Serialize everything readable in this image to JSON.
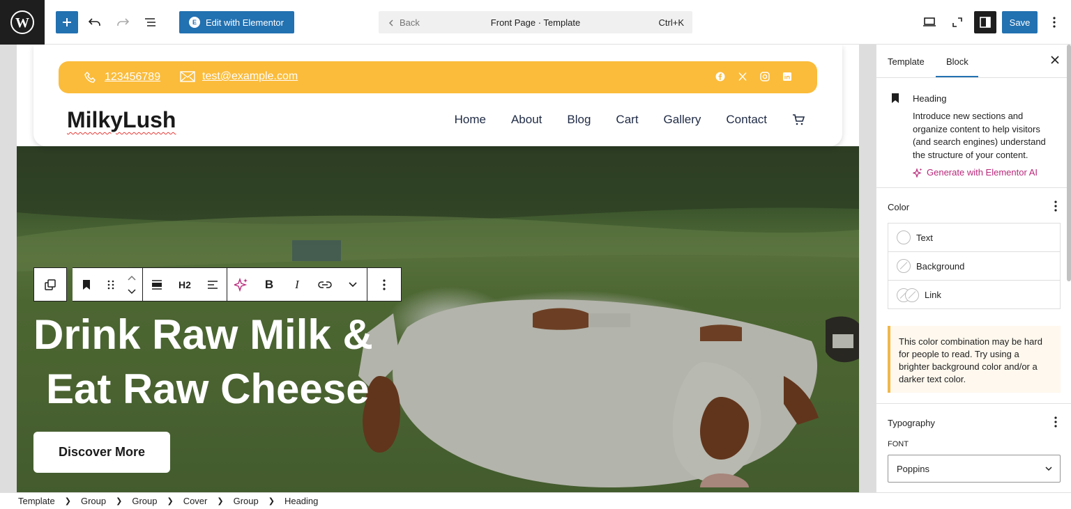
{
  "topbar": {
    "edit_with_elementor": "Edit with Elementor",
    "elementor_badge": "E",
    "back_label": "Back",
    "document_title": "Front Page · Template",
    "shortcut": "Ctrl+K",
    "save_label": "Save"
  },
  "site": {
    "phone": "123456789",
    "email": "test@example.com",
    "logo": "MilkyLush",
    "nav": [
      "Home",
      "About",
      "Blog",
      "Cart",
      "Gallery",
      "Contact"
    ],
    "social_icons": [
      "facebook-icon",
      "x-icon",
      "instagram-icon",
      "linkedin-icon"
    ],
    "accent_color": "#fbbc3b"
  },
  "hero": {
    "title_line1": "Drink Raw Milk &",
    "title_line2": "Eat Raw Cheese",
    "button": "Discover More"
  },
  "block_toolbar": {
    "heading_level": "H2",
    "bold": "B",
    "italic": "I"
  },
  "sidebar": {
    "tabs": [
      "Template",
      "Block"
    ],
    "active_tab": "Block",
    "block": {
      "name": "Heading",
      "description": "Introduce new sections and organize content to help visitors (and search engines) understand the structure of your content.",
      "ai_link": "Generate with Elementor AI"
    },
    "color": {
      "title": "Color",
      "items": [
        "Text",
        "Background",
        "Link"
      ]
    },
    "notice": "This color combination may be hard for people to read. Try using a brighter background color and/or a darker text color.",
    "typography": {
      "title": "Typography",
      "font_label": "FONT",
      "font_value": "Poppins"
    }
  },
  "breadcrumb": [
    "Template",
    "Group",
    "Group",
    "Cover",
    "Group",
    "Heading"
  ]
}
